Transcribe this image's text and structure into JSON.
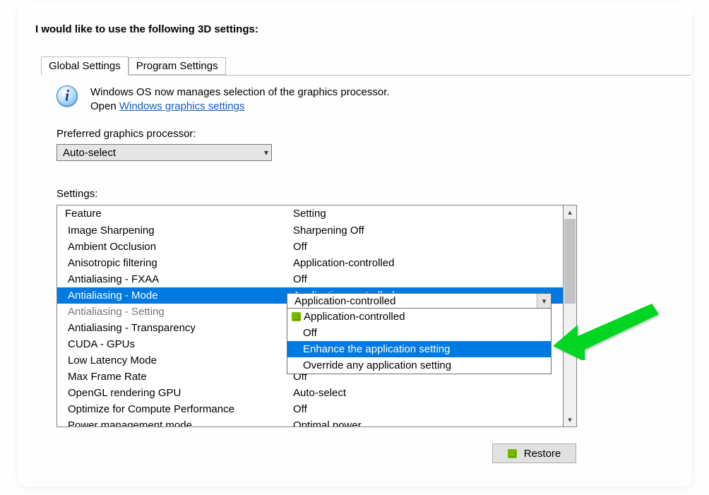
{
  "heading": "I would like to use the following 3D settings:",
  "tabs": {
    "global": "Global Settings",
    "program": "Program Settings"
  },
  "info": {
    "line1": "Windows OS now manages selection of the graphics processor.",
    "line2_prefix": "Open ",
    "line2_link": "Windows graphics settings"
  },
  "pref": {
    "label": "Preferred graphics processor:",
    "value": "Auto-select"
  },
  "settings_label": "Settings:",
  "columns": {
    "a": "Feature",
    "b": "Setting"
  },
  "rows": [
    {
      "feature": "Image Sharpening",
      "setting": "Sharpening Off"
    },
    {
      "feature": "Ambient Occlusion",
      "setting": "Off"
    },
    {
      "feature": "Anisotropic filtering",
      "setting": "Application-controlled"
    },
    {
      "feature": "Antialiasing - FXAA",
      "setting": "Off"
    },
    {
      "feature": "Antialiasing - Mode",
      "setting": "Application-controlled",
      "hilite": true
    },
    {
      "feature": "Antialiasing - Setting",
      "setting": "",
      "disabled": true
    },
    {
      "feature": "Antialiasing - Transparency",
      "setting": ""
    },
    {
      "feature": "CUDA - GPUs",
      "setting": ""
    },
    {
      "feature": "Low Latency Mode",
      "setting": ""
    },
    {
      "feature": "Max Frame Rate",
      "setting": "Off"
    },
    {
      "feature": "OpenGL rendering GPU",
      "setting": "Auto-select"
    },
    {
      "feature": "Optimize for Compute Performance",
      "setting": "Off"
    },
    {
      "feature": "Power management mode",
      "setting": "Optimal power"
    }
  ],
  "combo_value": "Application-controlled",
  "dropdown_options": [
    "Application-controlled",
    "Off",
    "Enhance the application setting",
    "Override any application setting"
  ],
  "dropdown_selected_index": 2,
  "restore_label": "Restore"
}
